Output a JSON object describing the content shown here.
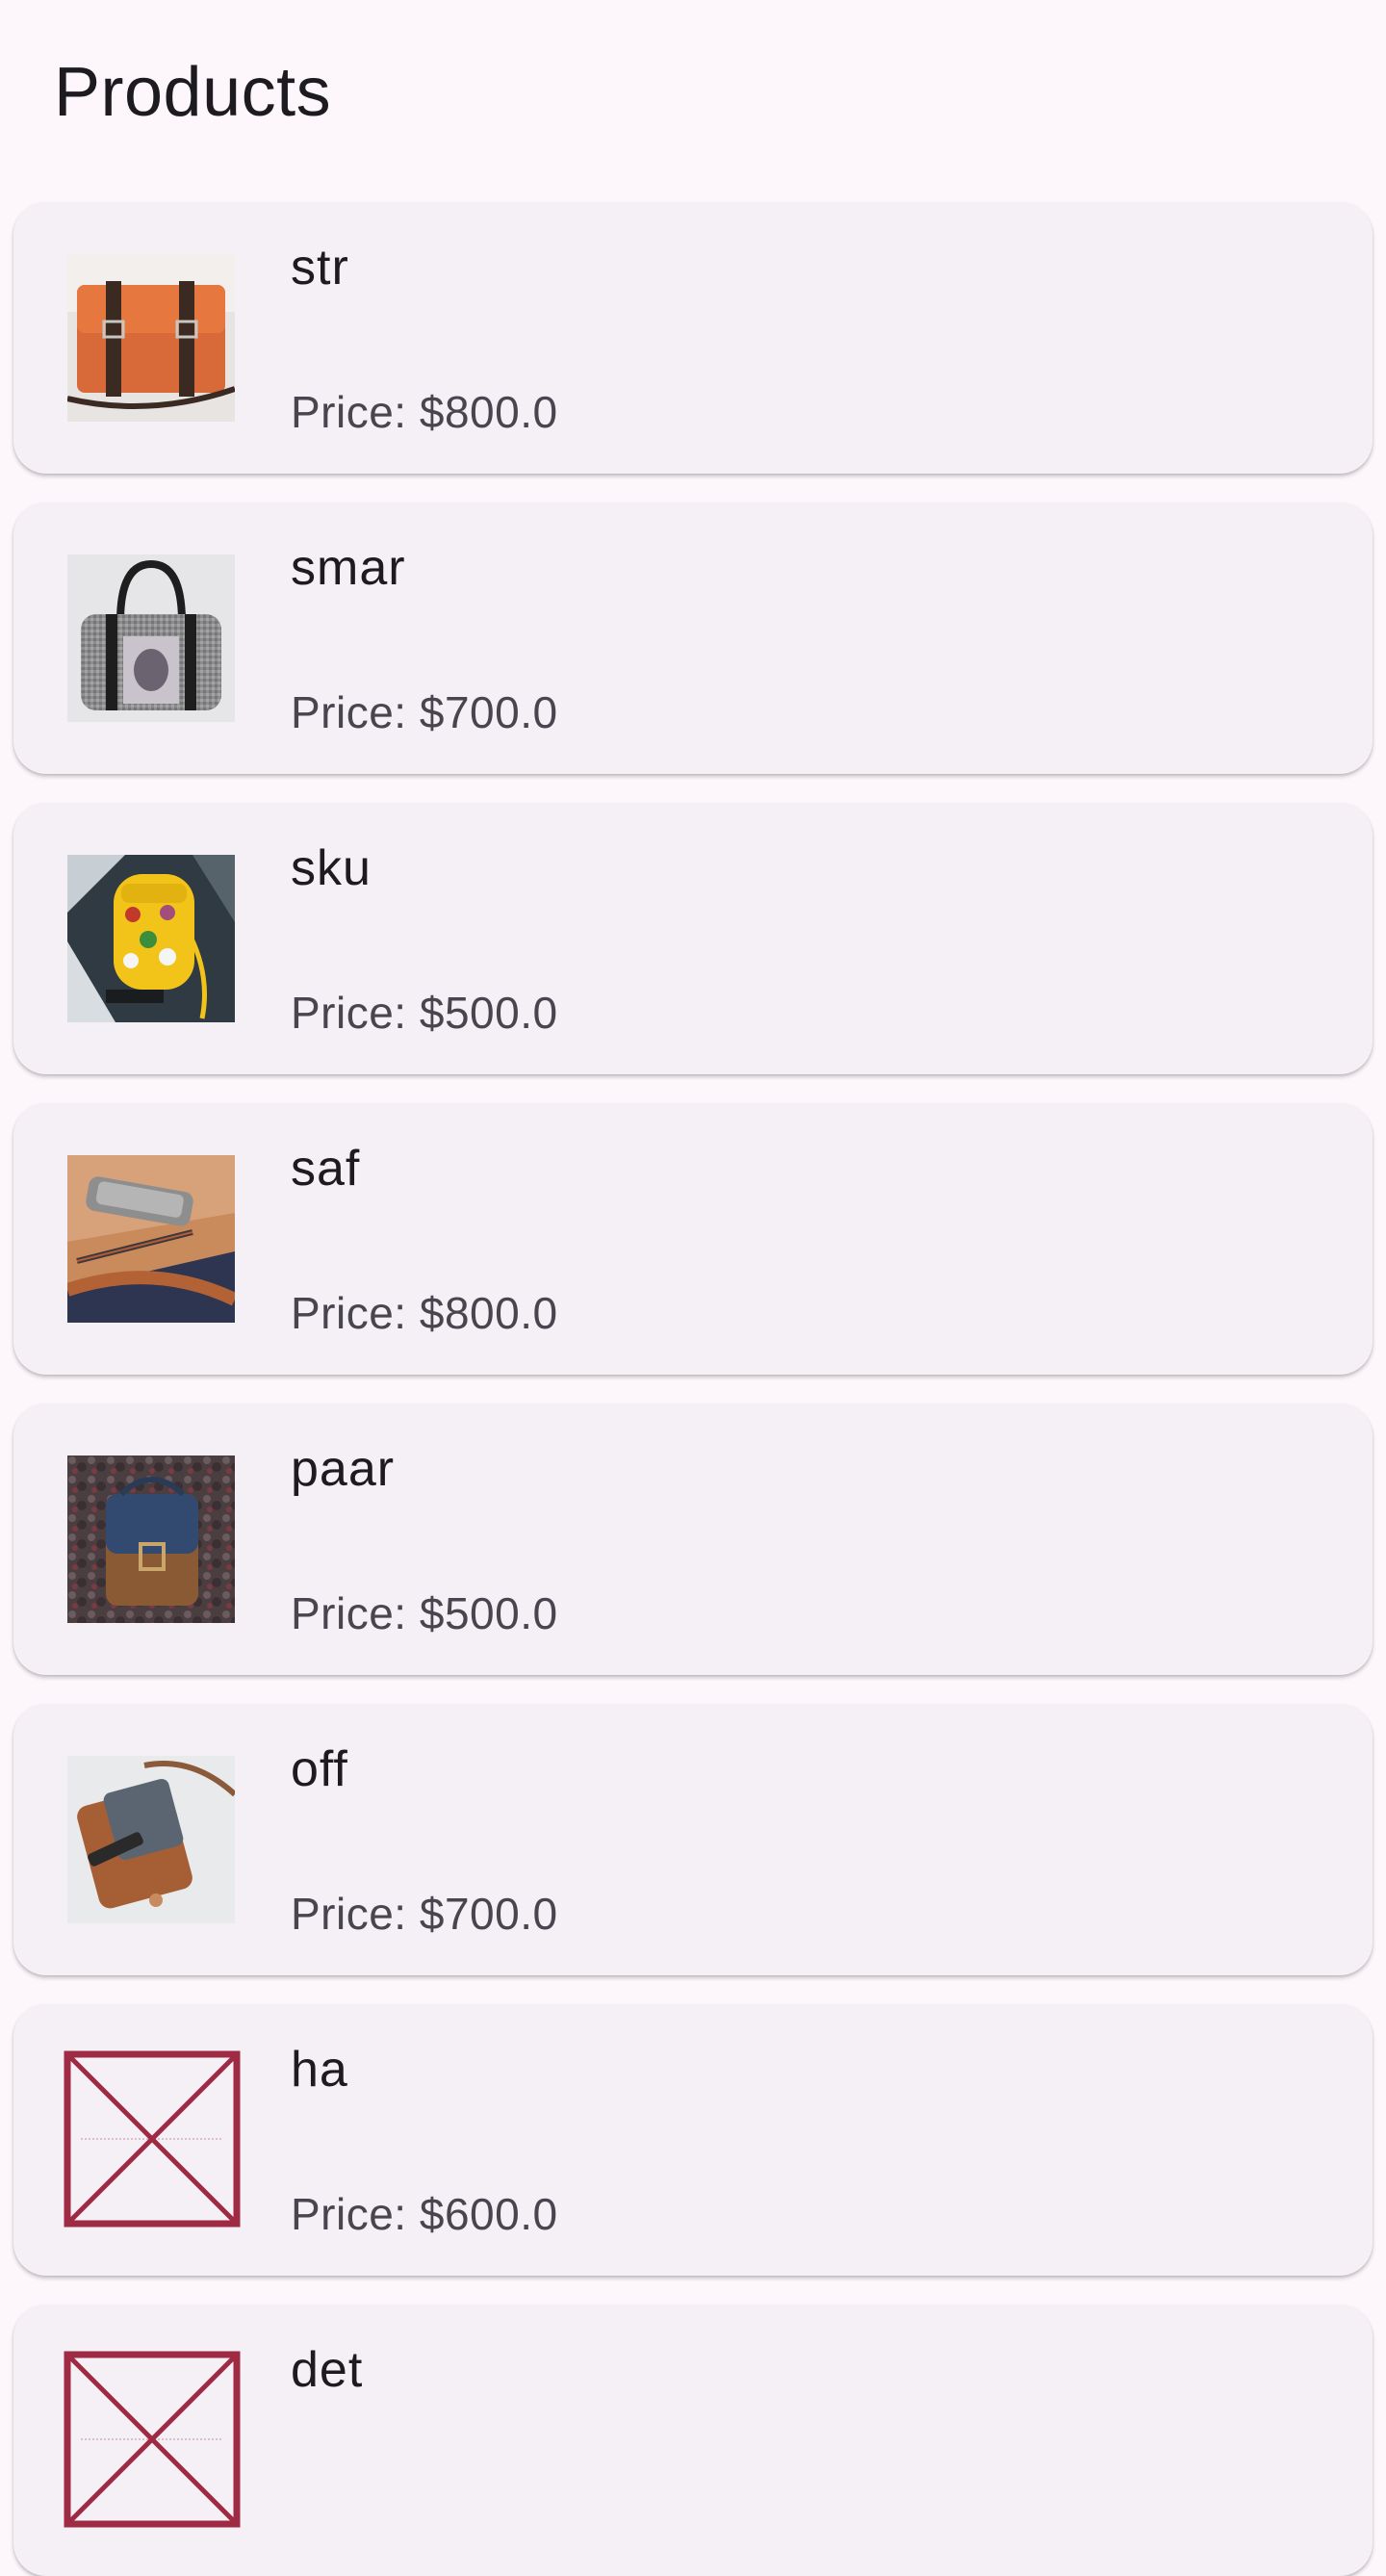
{
  "app_bar": {
    "title": "Products"
  },
  "products": [
    {
      "name": "str",
      "price_label": "Price: $800.0",
      "image": "orange-leather-satchel-photo"
    },
    {
      "name": "smar",
      "price_label": "Price: $700.0",
      "image": "gray-handbag-photo"
    },
    {
      "name": "sku",
      "price_label": "Price: $500.0",
      "image": "yellow-backpack-photo"
    },
    {
      "name": "saf",
      "price_label": "Price: $800.0",
      "image": "leather-bag-contents-photo"
    },
    {
      "name": "paar",
      "price_label": "Price: $500.0",
      "image": "blue-leather-bag-photo"
    },
    {
      "name": "off",
      "price_label": "Price: $700.0",
      "image": "open-bag-flatlay-photo"
    },
    {
      "name": "ha",
      "price_label": "Price: $600.0",
      "image": "broken-image-icon"
    },
    {
      "name": "det",
      "price_label": "",
      "image": "broken-image-icon"
    }
  ],
  "colors": {
    "background": "#fdf7fb",
    "card": "#f4f0f6",
    "broken_image_stroke": "#9e2a44",
    "price_text": "#49454f"
  }
}
